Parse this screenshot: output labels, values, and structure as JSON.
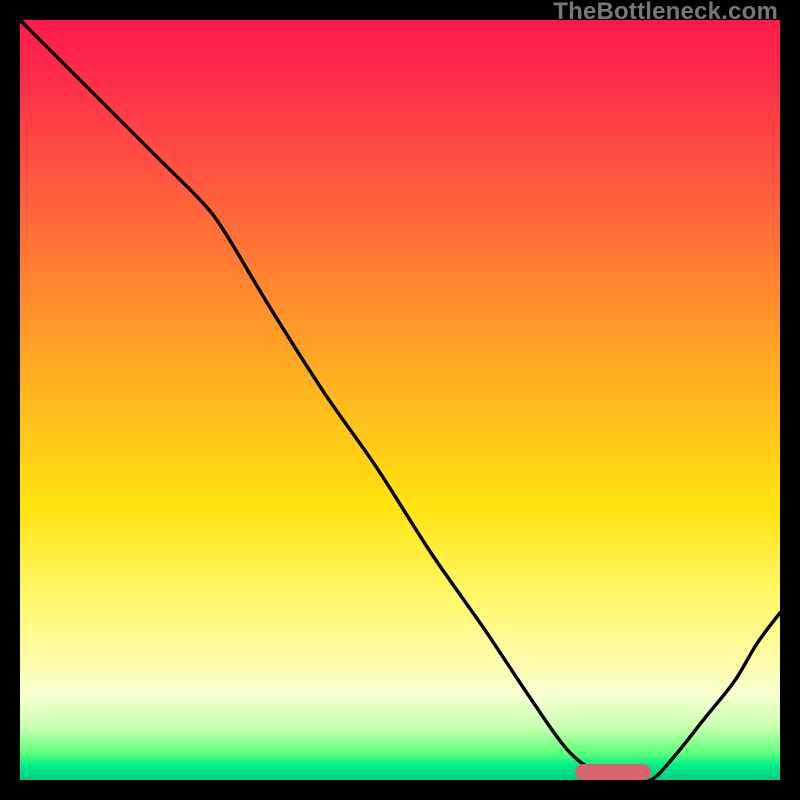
{
  "watermark": "TheBottleneck.com",
  "colors": {
    "gradient_top": "#ff1a4b",
    "gradient_mid1": "#ff8a2e",
    "gradient_mid2": "#ffe30f",
    "gradient_bottom": "#00d084",
    "curve": "#000000",
    "marker": "#d9636f",
    "frame": "#000000"
  },
  "chart_data": {
    "type": "line",
    "title": "",
    "xlabel": "",
    "ylabel": "",
    "xlim": [
      0,
      100
    ],
    "ylim": [
      0,
      100
    ],
    "grid": false,
    "legend": false,
    "annotations": [
      {
        "kind": "marker-pill",
        "x_range": [
          73,
          83
        ],
        "y": 1,
        "color": "#d9636f"
      }
    ],
    "series": [
      {
        "name": "bottleneck-curve",
        "color": "#000000",
        "x": [
          0,
          6,
          12,
          18,
          24,
          27,
          33,
          40,
          47,
          54,
          61,
          67,
          72,
          76,
          80,
          83,
          86,
          90,
          94,
          97,
          100
        ],
        "y": [
          100,
          94,
          88,
          82,
          76,
          72,
          62,
          51,
          41,
          30,
          20,
          11,
          4,
          1,
          0,
          0,
          3,
          8,
          13,
          18,
          22
        ]
      }
    ]
  }
}
